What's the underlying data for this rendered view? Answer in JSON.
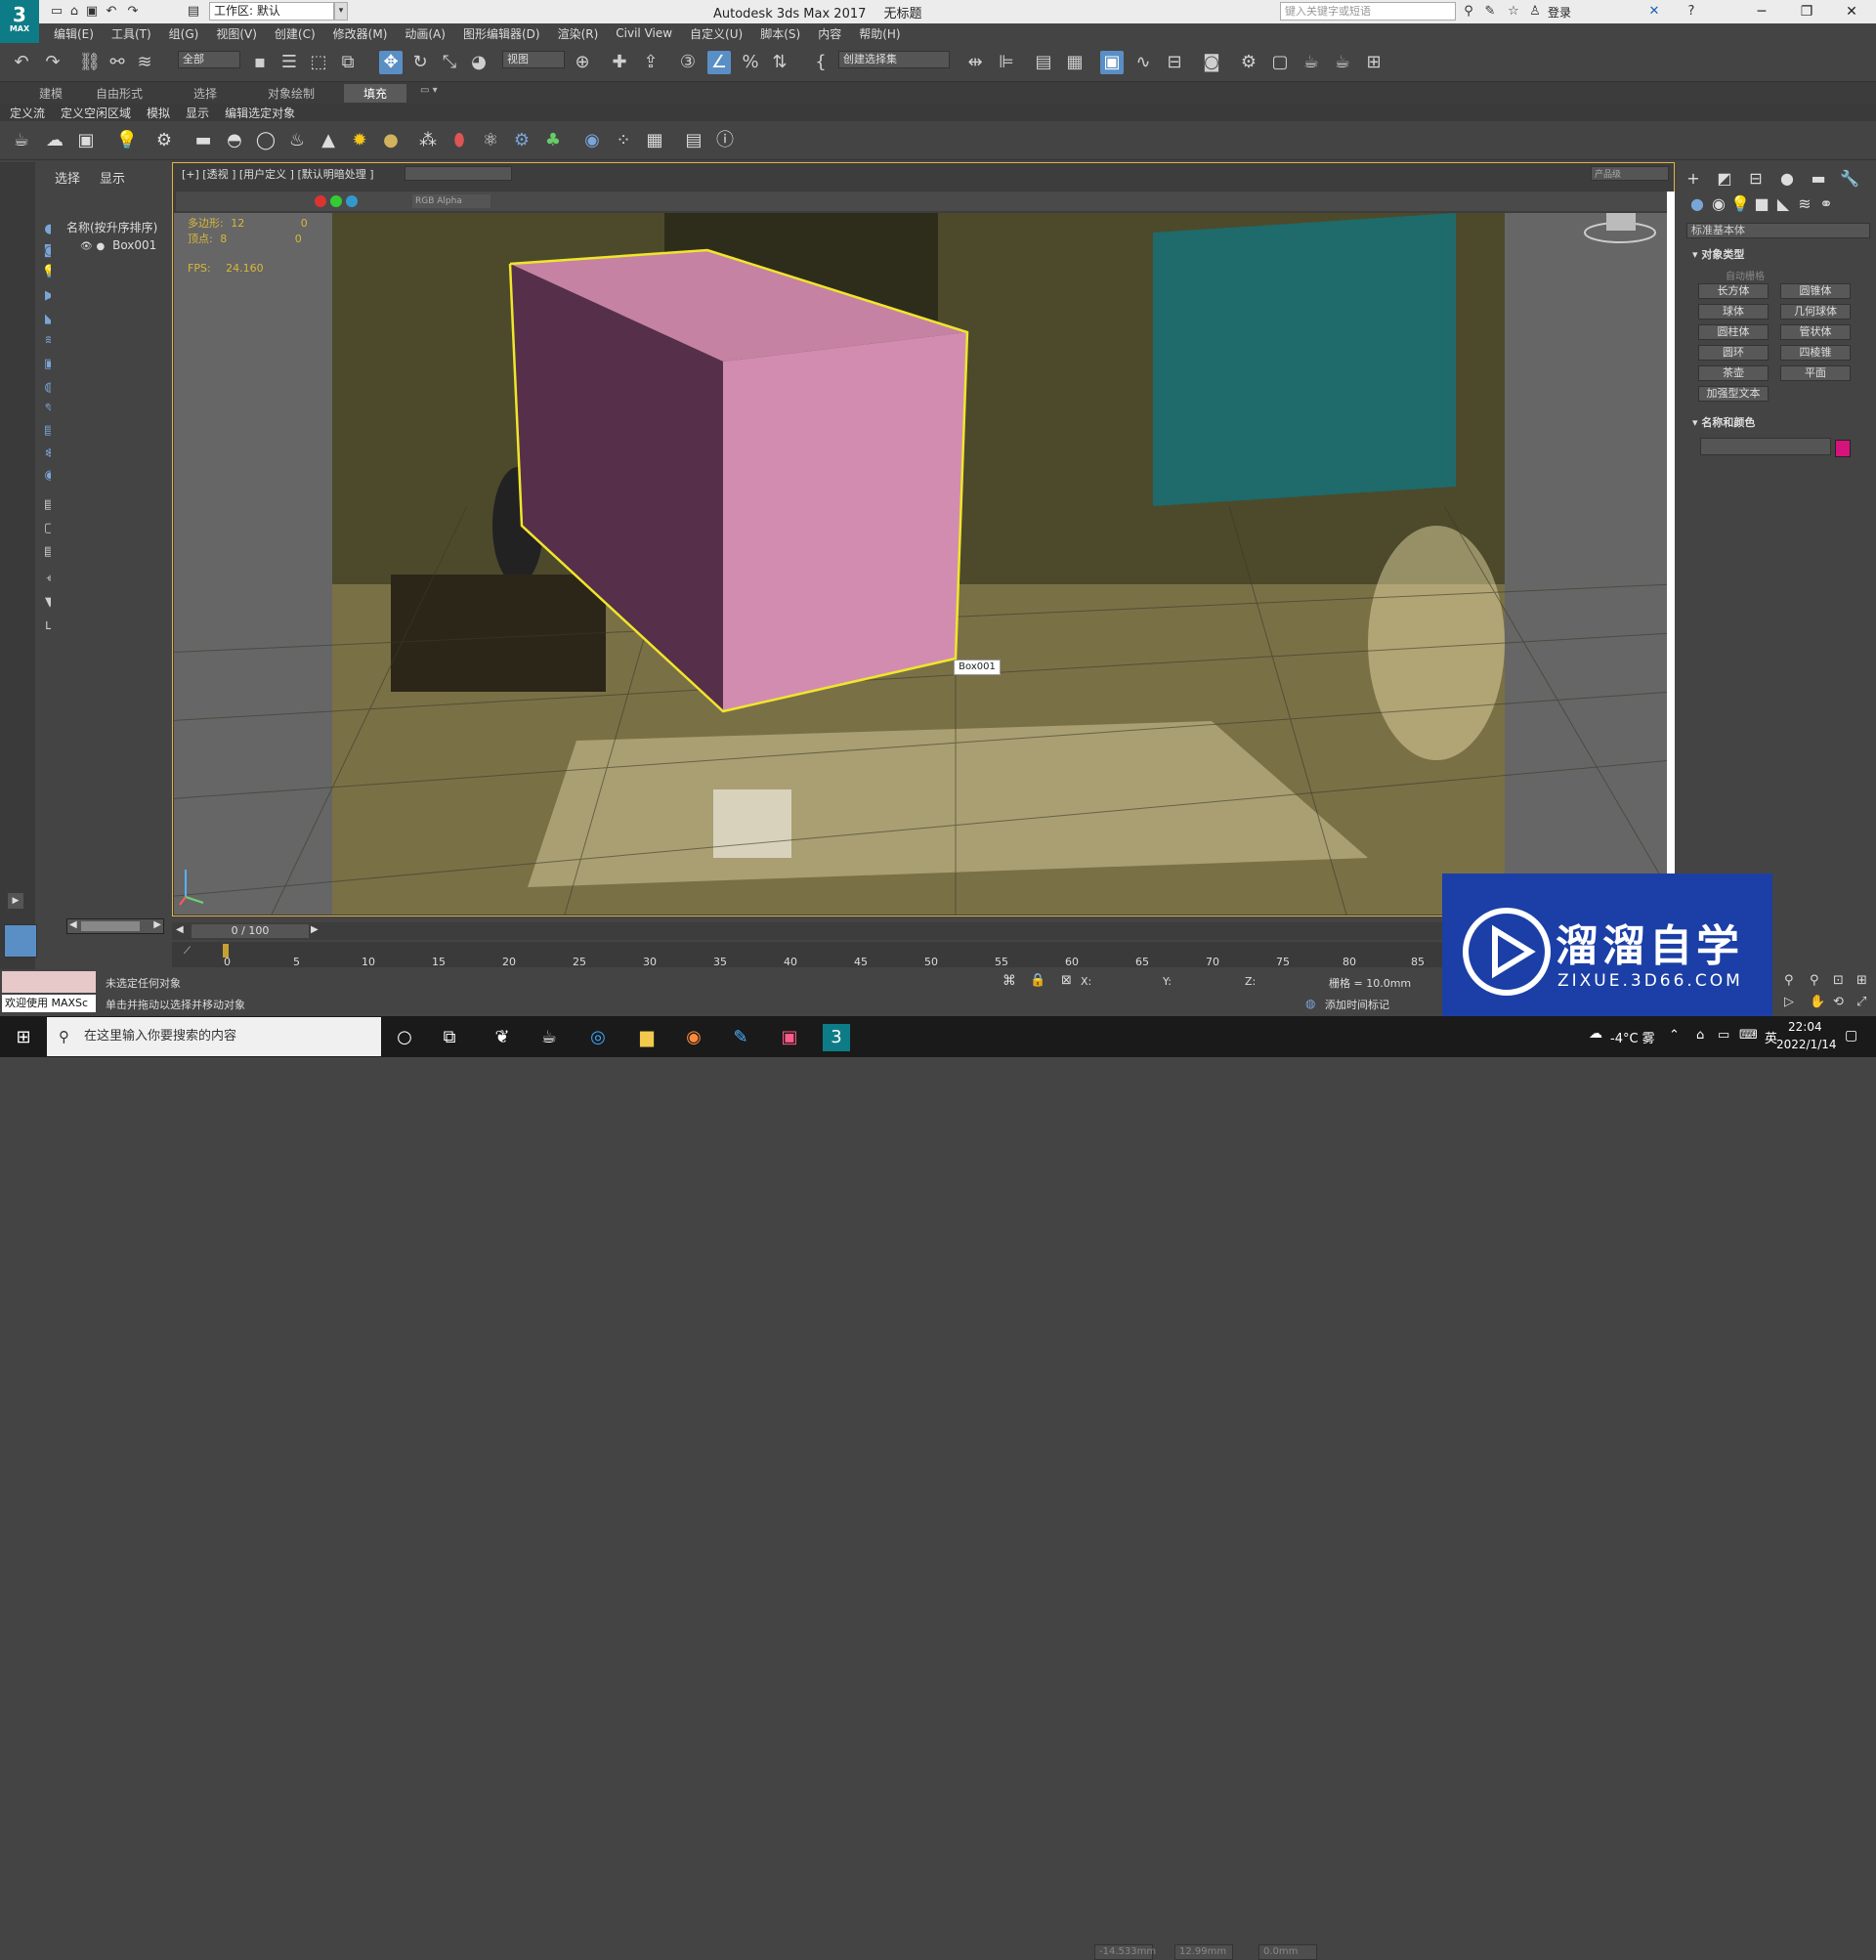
{
  "app": {
    "window_title": "Autodesk 3ds Max 2017",
    "doc_title": "无标题",
    "workspace": "工作区: 默认",
    "search_placeholder": "键入关键字或短语",
    "login": "登录",
    "logo_text": "MAX"
  },
  "menu": [
    "编辑(E)",
    "工具(T)",
    "组(G)",
    "视图(V)",
    "创建(C)",
    "修改器(M)",
    "动画(A)",
    "图形编辑器(D)",
    "渲染(R)",
    "Civil View",
    "自定义(U)",
    "脚本(S)",
    "内容",
    "帮助(H)"
  ],
  "toolbar": {
    "filter": "全部",
    "refcoord": "视图",
    "selset": "创建选择集"
  },
  "ribbon": {
    "tabs": [
      "建模",
      "自由形式",
      "选择",
      "对象绘制",
      "填充"
    ],
    "active_tab": "填充",
    "sub": [
      "定义流",
      "定义空闲区域",
      "模拟",
      "显示",
      "编辑选定对象"
    ]
  },
  "explorer": {
    "tabs": [
      "选择",
      "显示"
    ],
    "header": "名称(按升序排序)",
    "items": [
      "Box001"
    ]
  },
  "viewport": {
    "label": "[+] [透视 ] [用户定义 ] [默认明暗处理 ]",
    "channel": "RGB Alpha",
    "render_preset": "产品级",
    "stats": {
      "poly_label": "多边形:",
      "poly_val": "12",
      "poly_val2": "0",
      "vert_label": "顶点:",
      "vert_val": "8",
      "vert_val2": "0",
      "fps_label": "FPS:",
      "fps_val": "24.160"
    },
    "object_label": "Box001",
    "box_color": "#cc85a8",
    "selection_color": "#f0e62a"
  },
  "cmdpanel": {
    "dropdown": "标准基本体",
    "object_type_title": "对象类型",
    "autogrid": "自动栅格",
    "buttons": [
      "长方体",
      "圆锥体",
      "球体",
      "几何球体",
      "圆柱体",
      "管状体",
      "圆环",
      "四棱锥",
      "茶壶",
      "平面",
      "加强型文本"
    ],
    "name_color_title": "名称和颜色",
    "swatch_color": "#d4147a"
  },
  "timeline": {
    "position": "0 / 100",
    "ticks": [
      "0",
      "5",
      "10",
      "15",
      "20",
      "25",
      "30",
      "35",
      "40",
      "45",
      "50",
      "55",
      "60",
      "65",
      "70",
      "75",
      "80",
      "85"
    ]
  },
  "status": {
    "selection": "未选定任何对象",
    "prompt": "单击并拖动以选择并移动对象",
    "maxscript": "欢迎使用 MAXSc",
    "x_label": "X:",
    "x_val": "-14.533mm",
    "y_label": "Y:",
    "y_val": "12.99mm",
    "z_label": "Z:",
    "z_val": "0.0mm",
    "grid": "栅格 = 10.0mm",
    "add_timetag": "添加时间标记"
  },
  "taskbar": {
    "search_placeholder": "在这里输入你要搜索的内容",
    "weather": "-4°C 雾",
    "time": "22:04",
    "date": "2022/1/14",
    "ime": "英"
  },
  "watermark": {
    "title": "溜溜自学",
    "url": "ZIXUE.3D66.COM"
  }
}
